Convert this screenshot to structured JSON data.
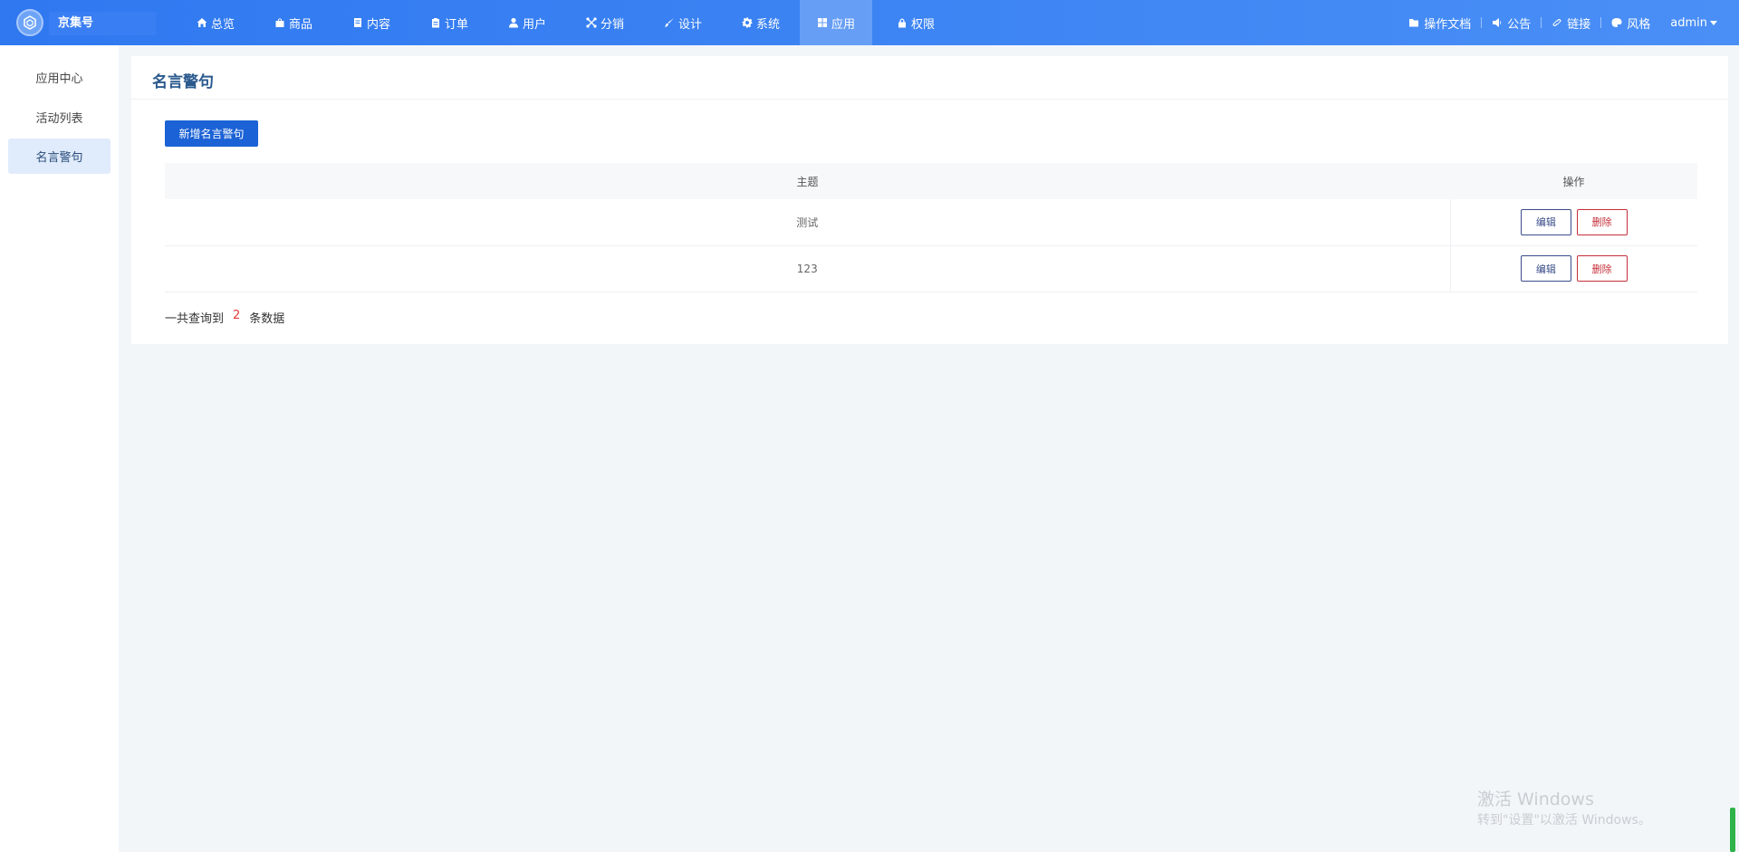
{
  "brand": {
    "name": "京集号"
  },
  "nav": [
    {
      "label": "总览",
      "icon": "home-icon"
    },
    {
      "label": "商品",
      "icon": "bag-icon"
    },
    {
      "label": "内容",
      "icon": "document-icon"
    },
    {
      "label": "订单",
      "icon": "clipboard-icon"
    },
    {
      "label": "用户",
      "icon": "user-icon"
    },
    {
      "label": "分销",
      "icon": "share-icon"
    },
    {
      "label": "设计",
      "icon": "brush-icon"
    },
    {
      "label": "系统",
      "icon": "gear-icon"
    },
    {
      "label": "应用",
      "icon": "grid-icon",
      "active": true
    },
    {
      "label": "权限",
      "icon": "lock-icon"
    }
  ],
  "right_menu": {
    "docs": "操作文档",
    "notice": "公告",
    "link": "链接",
    "style": "风格",
    "user": "admin"
  },
  "sidebar": {
    "items": [
      {
        "label": "应用中心"
      },
      {
        "label": "活动列表"
      },
      {
        "label": "名言警句",
        "active": true
      }
    ]
  },
  "page": {
    "title": "名言警句",
    "add_button": "新增名言警句"
  },
  "table": {
    "columns": [
      "主题",
      "操作"
    ],
    "rows": [
      {
        "subject": "测试",
        "edit": "编辑",
        "delete": "删除"
      },
      {
        "subject": "123",
        "edit": "编辑",
        "delete": "删除"
      }
    ]
  },
  "summary": {
    "prefix": "一共查询到",
    "count": "2",
    "suffix": "条数据"
  },
  "watermark": {
    "line1": "激活 Windows",
    "line2": "转到\"设置\"以激活 Windows。"
  },
  "colors": {
    "topbar": "#3a80f2",
    "primary_button": "#1b62d6",
    "delete": "#c62f3a",
    "sidebar_active": "#e0ebfb"
  }
}
